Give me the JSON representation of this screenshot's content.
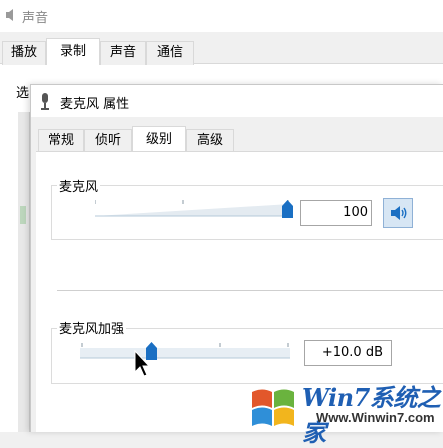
{
  "outer_window": {
    "title": "声音",
    "tabs": [
      {
        "label": "播放",
        "active": false
      },
      {
        "label": "录制",
        "active": true
      },
      {
        "label": "声音",
        "active": false
      },
      {
        "label": "通信",
        "active": false
      }
    ],
    "partial_text": "选"
  },
  "dialog": {
    "title": "麦克风 属性",
    "tabs": [
      {
        "label": "常规",
        "active": false
      },
      {
        "label": "侦听",
        "active": false
      },
      {
        "label": "级别",
        "active": true
      },
      {
        "label": "高级",
        "active": false
      }
    ],
    "microphone": {
      "label": "麦克风",
      "level": 100,
      "value_text": "100",
      "mute_icon": "speaker-icon"
    },
    "boost": {
      "label": "麦克风加强",
      "level_fraction": 0.33,
      "value_text": "+10.0 dB"
    }
  },
  "watermark": {
    "name": "Win7系统之家",
    "url": "Www.Winwin7.com"
  },
  "colors": {
    "accent": "#1a6fc3",
    "watermark_blue": "#1f5fb3"
  }
}
